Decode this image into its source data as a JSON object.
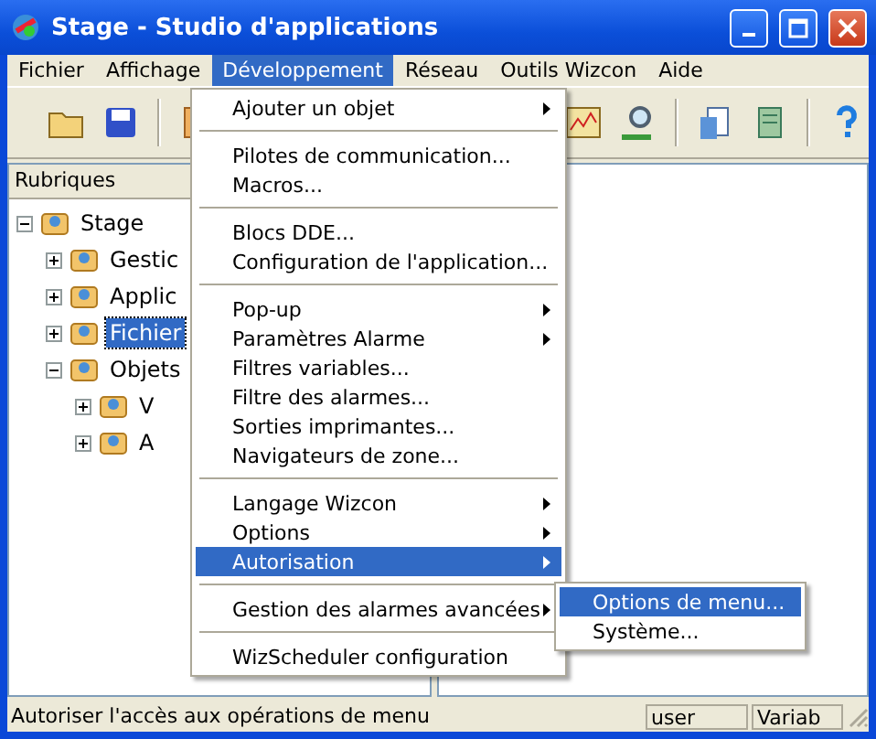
{
  "window": {
    "title": "Stage - Studio d'applications"
  },
  "menubar": [
    {
      "label": "Fichier",
      "selected": false
    },
    {
      "label": "Affichage",
      "selected": false
    },
    {
      "label": "Développement",
      "selected": true
    },
    {
      "label": "Réseau",
      "selected": false
    },
    {
      "label": "Outils Wizcon",
      "selected": false
    },
    {
      "label": "Aide",
      "selected": false
    }
  ],
  "tree": {
    "header": "Rubriques",
    "items": [
      {
        "label": "Stage",
        "expanded": true,
        "selected": false,
        "children": [
          {
            "label": "Gestic",
            "expanded": false,
            "selected": false
          },
          {
            "label": "Applic",
            "expanded": false,
            "selected": false
          },
          {
            "label": "Fichier",
            "expanded": false,
            "selected": true
          },
          {
            "label": "Objets",
            "expanded": true,
            "selected": false,
            "children": [
              {
                "label": "V",
                "expanded": false,
                "selected": false
              },
              {
                "label": "A",
                "expanded": false,
                "selected": false
              }
            ]
          }
        ]
      }
    ]
  },
  "menu": [
    {
      "kind": "item",
      "label": "Ajouter un objet",
      "submenu": true,
      "selected": false
    },
    {
      "kind": "separator"
    },
    {
      "kind": "item",
      "label": "Pilotes de communication...",
      "submenu": false,
      "selected": false
    },
    {
      "kind": "item",
      "label": "Macros...",
      "submenu": false,
      "selected": false
    },
    {
      "kind": "separator"
    },
    {
      "kind": "item",
      "label": "Blocs DDE...",
      "submenu": false,
      "selected": false
    },
    {
      "kind": "item",
      "label": "Configuration de l'application...",
      "submenu": false,
      "selected": false
    },
    {
      "kind": "separator"
    },
    {
      "kind": "item",
      "label": "Pop-up",
      "submenu": true,
      "selected": false
    },
    {
      "kind": "item",
      "label": "Paramètres Alarme",
      "submenu": true,
      "selected": false
    },
    {
      "kind": "item",
      "label": "Filtres variables...",
      "submenu": false,
      "selected": false
    },
    {
      "kind": "item",
      "label": "Filtre des alarmes...",
      "submenu": false,
      "selected": false
    },
    {
      "kind": "item",
      "label": "Sorties imprimantes...",
      "submenu": false,
      "selected": false
    },
    {
      "kind": "item",
      "label": "Navigateurs de zone...",
      "submenu": false,
      "selected": false
    },
    {
      "kind": "separator"
    },
    {
      "kind": "item",
      "label": "Langage Wizcon",
      "submenu": true,
      "selected": false
    },
    {
      "kind": "item",
      "label": "Options",
      "submenu": true,
      "selected": false
    },
    {
      "kind": "item",
      "label": "Autorisation",
      "submenu": true,
      "selected": true
    },
    {
      "kind": "separator"
    },
    {
      "kind": "item",
      "label": "Gestion des alarmes avancées",
      "submenu": true,
      "selected": false
    },
    {
      "kind": "separator"
    },
    {
      "kind": "item",
      "label": "WizScheduler configuration",
      "submenu": false,
      "selected": false
    }
  ],
  "submenu": [
    {
      "label": "Options de menu...",
      "selected": true
    },
    {
      "label": "Système...",
      "selected": false
    }
  ],
  "status_bar": {
    "message": "Autoriser l'accès aux opérations de menu",
    "panes": [
      "user",
      "Variab"
    ]
  }
}
